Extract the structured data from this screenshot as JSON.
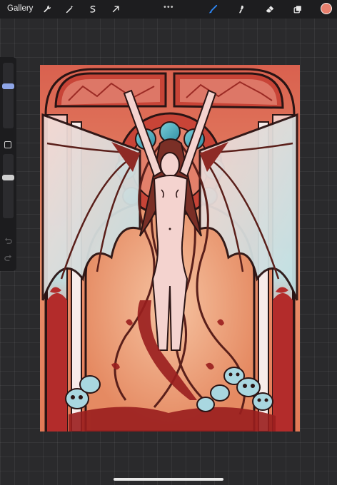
{
  "toolbar": {
    "gallery_label": "Gallery",
    "left_tools": [
      {
        "name": "actions-wrench-icon"
      },
      {
        "name": "adjustments-magic-wand-icon"
      },
      {
        "name": "selection-icon"
      },
      {
        "name": "transform-arrow-icon"
      }
    ],
    "more_label": "•••",
    "right_tools": [
      {
        "name": "brush-icon",
        "active": true
      },
      {
        "name": "smudge-icon"
      },
      {
        "name": "eraser-icon"
      },
      {
        "name": "layers-icon"
      }
    ],
    "current_color": "#e8806e",
    "accent": "#2f8cff"
  },
  "sidebar": {
    "brush_size_level": 0.35,
    "opacity_level": 0.65
  },
  "artwork": {
    "palette": {
      "background": "#e06b55",
      "arch": "#b6362b",
      "teal": "#57b7c7",
      "skin": "#f4d3cf",
      "hair": "#6a2a23",
      "outline": "#2a1414",
      "blood": "#9a1e1e",
      "skull": "#a9d7e0"
    }
  }
}
